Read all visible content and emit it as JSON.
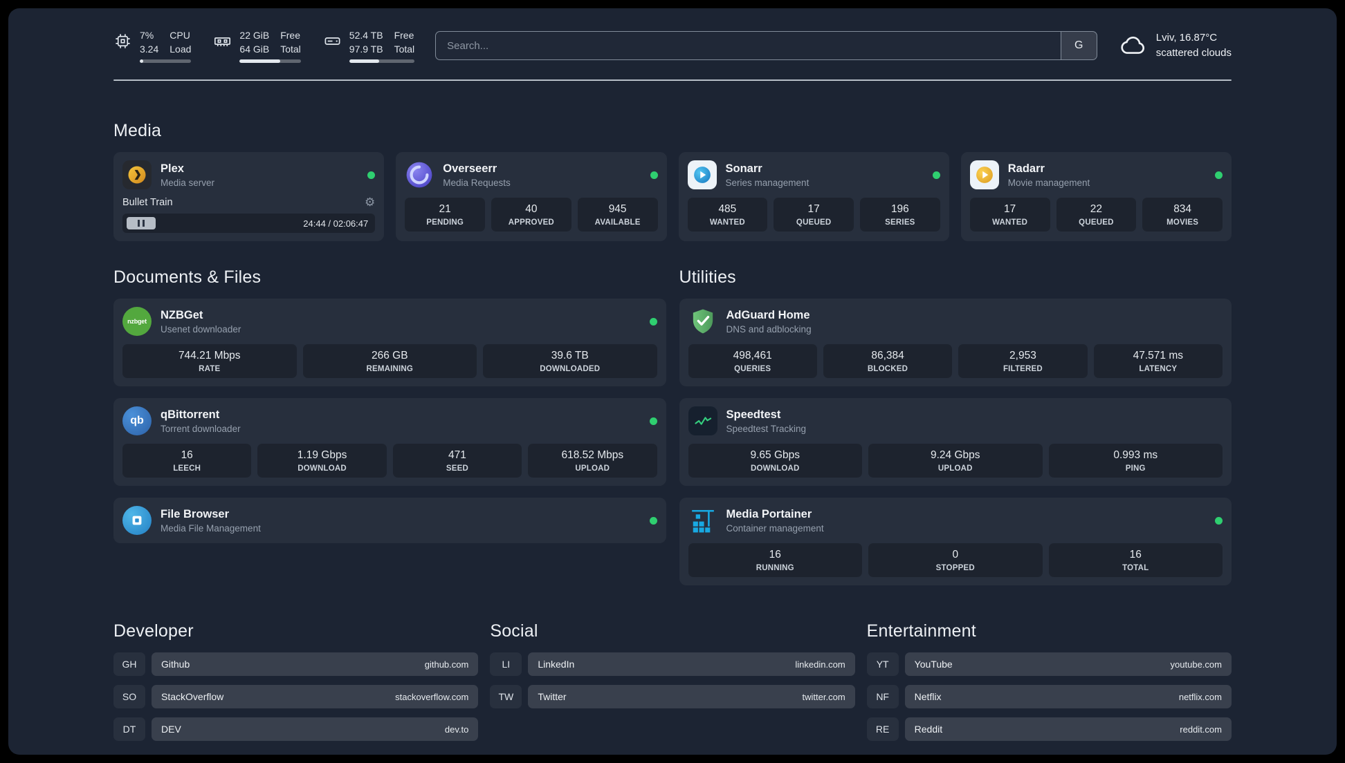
{
  "colors": {
    "status_online": "#2fcf70"
  },
  "header": {
    "resources": {
      "cpu": {
        "value": "7%",
        "load": "3.24",
        "label_top": "CPU",
        "label_bottom": "Load",
        "percent": 7
      },
      "memory": {
        "free": "22 GiB",
        "total": "64 GiB",
        "free_label": "Free",
        "total_label": "Total",
        "percent": 66
      },
      "disk": {
        "free": "52.4 TB",
        "total": "97.9 TB",
        "free_label": "Free",
        "total_label": "Total",
        "percent": 46
      }
    },
    "search": {
      "placeholder": "Search...",
      "button_label": "G"
    },
    "weather": {
      "location": "Lviv, 16.87°C",
      "condition": "scattered clouds"
    }
  },
  "sections": {
    "media": {
      "title": "Media",
      "services": [
        {
          "name": "Plex",
          "desc": "Media server",
          "player": {
            "track": "Bullet Train",
            "time": "24:44 / 02:06:47"
          }
        },
        {
          "name": "Overseerr",
          "desc": "Media Requests",
          "stats": [
            {
              "value": "21",
              "label": "PENDING"
            },
            {
              "value": "40",
              "label": "APPROVED"
            },
            {
              "value": "945",
              "label": "AVAILABLE"
            }
          ]
        },
        {
          "name": "Sonarr",
          "desc": "Series management",
          "stats": [
            {
              "value": "485",
              "label": "WANTED"
            },
            {
              "value": "17",
              "label": "QUEUED"
            },
            {
              "value": "196",
              "label": "SERIES"
            }
          ]
        },
        {
          "name": "Radarr",
          "desc": "Movie management",
          "stats": [
            {
              "value": "17",
              "label": "WANTED"
            },
            {
              "value": "22",
              "label": "QUEUED"
            },
            {
              "value": "834",
              "label": "MOVIES"
            }
          ]
        }
      ]
    },
    "documents": {
      "title": "Documents & Files",
      "services": [
        {
          "name": "NZBGet",
          "desc": "Usenet downloader",
          "stats": [
            {
              "value": "744.21 Mbps",
              "label": "RATE"
            },
            {
              "value": "266 GB",
              "label": "REMAINING"
            },
            {
              "value": "39.6 TB",
              "label": "DOWNLOADED"
            }
          ]
        },
        {
          "name": "qBittorrent",
          "desc": "Torrent downloader",
          "stats": [
            {
              "value": "16",
              "label": "LEECH"
            },
            {
              "value": "1.19 Gbps",
              "label": "DOWNLOAD"
            },
            {
              "value": "471",
              "label": "SEED"
            },
            {
              "value": "618.52 Mbps",
              "label": "UPLOAD"
            }
          ]
        },
        {
          "name": "File Browser",
          "desc": "Media File Management"
        }
      ]
    },
    "utilities": {
      "title": "Utilities",
      "services": [
        {
          "name": "AdGuard Home",
          "desc": "DNS and adblocking",
          "stats": [
            {
              "value": "498,461",
              "label": "QUERIES"
            },
            {
              "value": "86,384",
              "label": "BLOCKED"
            },
            {
              "value": "2,953",
              "label": "FILTERED"
            },
            {
              "value": "47.571 ms",
              "label": "LATENCY"
            }
          ]
        },
        {
          "name": "Speedtest",
          "desc": "Speedtest Tracking",
          "stats": [
            {
              "value": "9.65 Gbps",
              "label": "DOWNLOAD"
            },
            {
              "value": "9.24 Gbps",
              "label": "UPLOAD"
            },
            {
              "value": "0.993 ms",
              "label": "PING"
            }
          ]
        },
        {
          "name": "Media Portainer",
          "desc": "Container management",
          "stats": [
            {
              "value": "16",
              "label": "RUNNING"
            },
            {
              "value": "0",
              "label": "STOPPED"
            },
            {
              "value": "16",
              "label": "TOTAL"
            }
          ]
        }
      ]
    },
    "developer": {
      "title": "Developer",
      "bookmarks": [
        {
          "abbr": "GH",
          "name": "Github",
          "url": "github.com"
        },
        {
          "abbr": "SO",
          "name": "StackOverflow",
          "url": "stackoverflow.com"
        },
        {
          "abbr": "DT",
          "name": "DEV",
          "url": "dev.to"
        }
      ]
    },
    "social": {
      "title": "Social",
      "bookmarks": [
        {
          "abbr": "LI",
          "name": "LinkedIn",
          "url": "linkedin.com"
        },
        {
          "abbr": "TW",
          "name": "Twitter",
          "url": "twitter.com"
        }
      ]
    },
    "entertainment": {
      "title": "Entertainment",
      "bookmarks": [
        {
          "abbr": "YT",
          "name": "YouTube",
          "url": "youtube.com"
        },
        {
          "abbr": "NF",
          "name": "Netflix",
          "url": "netflix.com"
        },
        {
          "abbr": "RE",
          "name": "Reddit",
          "url": "reddit.com"
        }
      ]
    }
  }
}
